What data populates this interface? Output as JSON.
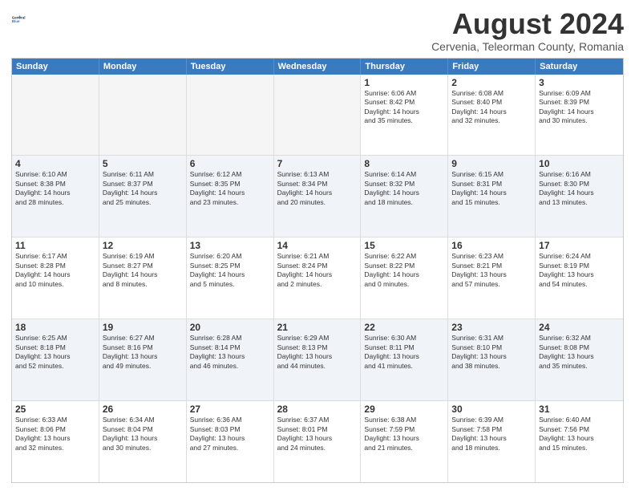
{
  "header": {
    "logo_line1": "General",
    "logo_line2": "Blue",
    "main_title": "August 2024",
    "subtitle": "Cervenia, Teleorman County, Romania"
  },
  "calendar": {
    "days_of_week": [
      "Sunday",
      "Monday",
      "Tuesday",
      "Wednesday",
      "Thursday",
      "Friday",
      "Saturday"
    ],
    "rows": [
      [
        {
          "day": "",
          "info": ""
        },
        {
          "day": "",
          "info": ""
        },
        {
          "day": "",
          "info": ""
        },
        {
          "day": "",
          "info": ""
        },
        {
          "day": "1",
          "info": "Sunrise: 6:06 AM\nSunset: 8:42 PM\nDaylight: 14 hours\nand 35 minutes."
        },
        {
          "day": "2",
          "info": "Sunrise: 6:08 AM\nSunset: 8:40 PM\nDaylight: 14 hours\nand 32 minutes."
        },
        {
          "day": "3",
          "info": "Sunrise: 6:09 AM\nSunset: 8:39 PM\nDaylight: 14 hours\nand 30 minutes."
        }
      ],
      [
        {
          "day": "4",
          "info": "Sunrise: 6:10 AM\nSunset: 8:38 PM\nDaylight: 14 hours\nand 28 minutes."
        },
        {
          "day": "5",
          "info": "Sunrise: 6:11 AM\nSunset: 8:37 PM\nDaylight: 14 hours\nand 25 minutes."
        },
        {
          "day": "6",
          "info": "Sunrise: 6:12 AM\nSunset: 8:35 PM\nDaylight: 14 hours\nand 23 minutes."
        },
        {
          "day": "7",
          "info": "Sunrise: 6:13 AM\nSunset: 8:34 PM\nDaylight: 14 hours\nand 20 minutes."
        },
        {
          "day": "8",
          "info": "Sunrise: 6:14 AM\nSunset: 8:32 PM\nDaylight: 14 hours\nand 18 minutes."
        },
        {
          "day": "9",
          "info": "Sunrise: 6:15 AM\nSunset: 8:31 PM\nDaylight: 14 hours\nand 15 minutes."
        },
        {
          "day": "10",
          "info": "Sunrise: 6:16 AM\nSunset: 8:30 PM\nDaylight: 14 hours\nand 13 minutes."
        }
      ],
      [
        {
          "day": "11",
          "info": "Sunrise: 6:17 AM\nSunset: 8:28 PM\nDaylight: 14 hours\nand 10 minutes."
        },
        {
          "day": "12",
          "info": "Sunrise: 6:19 AM\nSunset: 8:27 PM\nDaylight: 14 hours\nand 8 minutes."
        },
        {
          "day": "13",
          "info": "Sunrise: 6:20 AM\nSunset: 8:25 PM\nDaylight: 14 hours\nand 5 minutes."
        },
        {
          "day": "14",
          "info": "Sunrise: 6:21 AM\nSunset: 8:24 PM\nDaylight: 14 hours\nand 2 minutes."
        },
        {
          "day": "15",
          "info": "Sunrise: 6:22 AM\nSunset: 8:22 PM\nDaylight: 14 hours\nand 0 minutes."
        },
        {
          "day": "16",
          "info": "Sunrise: 6:23 AM\nSunset: 8:21 PM\nDaylight: 13 hours\nand 57 minutes."
        },
        {
          "day": "17",
          "info": "Sunrise: 6:24 AM\nSunset: 8:19 PM\nDaylight: 13 hours\nand 54 minutes."
        }
      ],
      [
        {
          "day": "18",
          "info": "Sunrise: 6:25 AM\nSunset: 8:18 PM\nDaylight: 13 hours\nand 52 minutes."
        },
        {
          "day": "19",
          "info": "Sunrise: 6:27 AM\nSunset: 8:16 PM\nDaylight: 13 hours\nand 49 minutes."
        },
        {
          "day": "20",
          "info": "Sunrise: 6:28 AM\nSunset: 8:14 PM\nDaylight: 13 hours\nand 46 minutes."
        },
        {
          "day": "21",
          "info": "Sunrise: 6:29 AM\nSunset: 8:13 PM\nDaylight: 13 hours\nand 44 minutes."
        },
        {
          "day": "22",
          "info": "Sunrise: 6:30 AM\nSunset: 8:11 PM\nDaylight: 13 hours\nand 41 minutes."
        },
        {
          "day": "23",
          "info": "Sunrise: 6:31 AM\nSunset: 8:10 PM\nDaylight: 13 hours\nand 38 minutes."
        },
        {
          "day": "24",
          "info": "Sunrise: 6:32 AM\nSunset: 8:08 PM\nDaylight: 13 hours\nand 35 minutes."
        }
      ],
      [
        {
          "day": "25",
          "info": "Sunrise: 6:33 AM\nSunset: 8:06 PM\nDaylight: 13 hours\nand 32 minutes."
        },
        {
          "day": "26",
          "info": "Sunrise: 6:34 AM\nSunset: 8:04 PM\nDaylight: 13 hours\nand 30 minutes."
        },
        {
          "day": "27",
          "info": "Sunrise: 6:36 AM\nSunset: 8:03 PM\nDaylight: 13 hours\nand 27 minutes."
        },
        {
          "day": "28",
          "info": "Sunrise: 6:37 AM\nSunset: 8:01 PM\nDaylight: 13 hours\nand 24 minutes."
        },
        {
          "day": "29",
          "info": "Sunrise: 6:38 AM\nSunset: 7:59 PM\nDaylight: 13 hours\nand 21 minutes."
        },
        {
          "day": "30",
          "info": "Sunrise: 6:39 AM\nSunset: 7:58 PM\nDaylight: 13 hours\nand 18 minutes."
        },
        {
          "day": "31",
          "info": "Sunrise: 6:40 AM\nSunset: 7:56 PM\nDaylight: 13 hours\nand 15 minutes."
        }
      ]
    ]
  }
}
